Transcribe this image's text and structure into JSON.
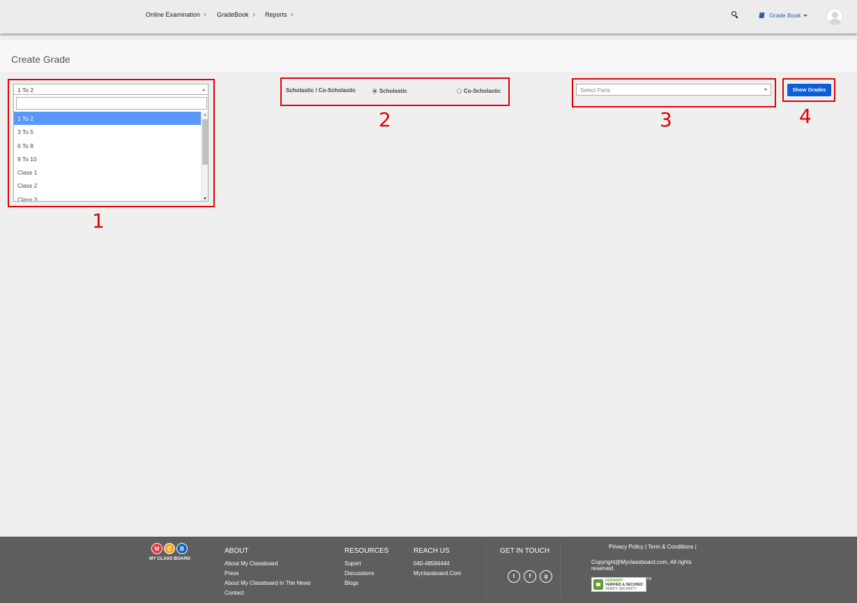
{
  "nav": {
    "items": [
      {
        "label": "Online Examination"
      },
      {
        "label": "GradeBook"
      },
      {
        "label": "Reports"
      }
    ],
    "gradebook_menu": "Grade Book",
    "icons": {
      "search": "search-icon",
      "gradebook": "book-icon",
      "avatar": "user-avatar-icon"
    }
  },
  "page": {
    "title": "Create Grade"
  },
  "class_select": {
    "selected": "1 To 2",
    "search_value": "",
    "options": [
      "1 To 2",
      "3 To 5",
      "6 To 8",
      "9 To 10",
      "Class 1",
      "Class 2",
      "Class 3"
    ],
    "highlighted_index": 0
  },
  "type_radio": {
    "label": "Scholastic / Co-Scholastic",
    "options": [
      {
        "label": "Scholastic",
        "checked": true
      },
      {
        "label": "Co-Scholastic",
        "checked": false
      }
    ]
  },
  "parts_select": {
    "placeholder": "Select Parts"
  },
  "show_button": {
    "label": "Show Grades"
  },
  "annotations": [
    "1",
    "2",
    "3",
    "4"
  ],
  "colors": {
    "accent": "#0b5ed7",
    "highlight": "#5897fb",
    "annotation": "#e00000",
    "footer_bg": "#5e5e5e"
  },
  "footer": {
    "logo_letters": [
      "M",
      "C",
      "B"
    ],
    "logo_text": "MY CLASS BOARD",
    "about": {
      "title": "ABOUT",
      "links": [
        "About My Classboard",
        "Press",
        "About My Classboard In The News",
        "Contact"
      ]
    },
    "resources": {
      "title": "RESOURCES",
      "links": [
        "Suport",
        "Discussions",
        "Blogs"
      ]
    },
    "reach": {
      "title": "REACH US",
      "lines": [
        "040-48584444",
        "Myclassboard.Com"
      ]
    },
    "touch": {
      "title": "GET IN TOUCH",
      "social": [
        "twitter-icon",
        "facebook-icon",
        "google-plus-icon"
      ]
    },
    "policy": "Privacy Policy | Term & Conditions |",
    "copyright": "Copyright@Myclassboard.com, All rights reserved.",
    "badge": {
      "brand": "GODADDY",
      "line1": "VERIFIED & SECURED",
      "line2": "VERIFY SECURITY",
      "tm": "TM"
    }
  }
}
